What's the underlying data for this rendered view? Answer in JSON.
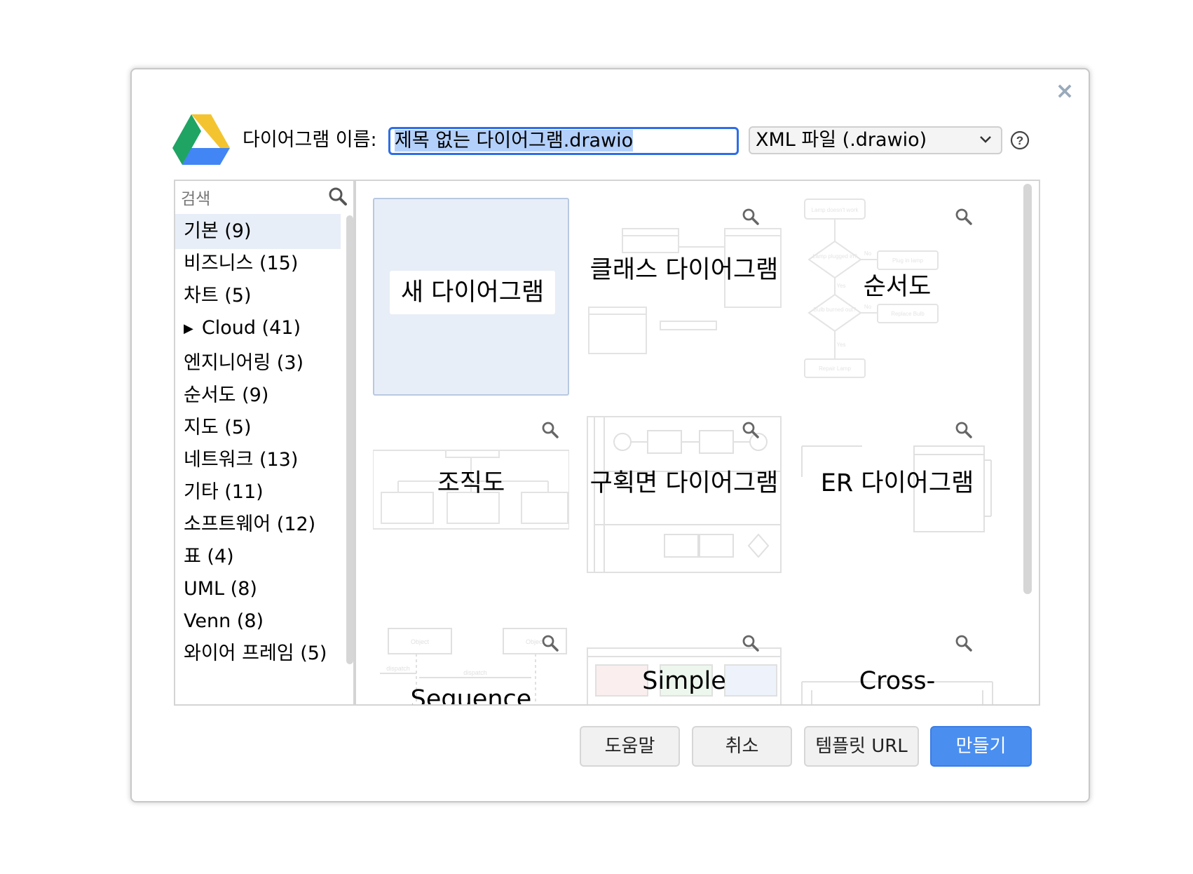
{
  "dialog": {
    "close_glyph": "×",
    "name_label": "다이어그램 이름:",
    "filename": "제목 없는 다이어그램.drawio",
    "format": "XML 파일 (.drawio)",
    "help_glyph": "?"
  },
  "search": {
    "placeholder": "검색"
  },
  "categories": [
    {
      "label": "기본 (9)",
      "active": true
    },
    {
      "label": "비즈니스 (15)"
    },
    {
      "label": "차트 (5)"
    },
    {
      "label": "Cloud (41)",
      "expandable": true,
      "arrow": "▶"
    },
    {
      "label": "엔지니어링 (3)"
    },
    {
      "label": "순서도 (9)"
    },
    {
      "label": "지도 (5)"
    },
    {
      "label": "네트워크 (13)"
    },
    {
      "label": "기타 (11)"
    },
    {
      "label": "소프트웨어 (12)"
    },
    {
      "label": "표 (4)"
    },
    {
      "label": "UML (8)"
    },
    {
      "label": "Venn (8)"
    },
    {
      "label": "와이어 프레임 (5)"
    }
  ],
  "templates": [
    {
      "label": "새 다이어그램",
      "selected": true
    },
    {
      "label": "클래스 다이어그램"
    },
    {
      "label": "순서도"
    },
    {
      "label": "조직도"
    },
    {
      "label": "구획면 다이어그램"
    },
    {
      "label": "ER 다이어그램"
    },
    {
      "label": "Sequence"
    },
    {
      "label": "Simple"
    },
    {
      "label": "Cross-"
    }
  ],
  "thumb_text": {
    "flow_1": "Lamp doesn't work",
    "flow_2": "Lamp plugged in?",
    "flow_3": "Plug in lamp",
    "flow_4": "Bulb burned out?",
    "flow_5": "Replace Bulb",
    "flow_6": "Repair Lamp",
    "flow_no": "No",
    "flow_yes": "Yes",
    "seq_1": "Object",
    "seq_2": "Object",
    "seq_3": "dispatch",
    "seq_4": "dispatch"
  },
  "buttons": {
    "help": "도움말",
    "cancel": "취소",
    "template_url": "템플릿 URL",
    "create": "만들기"
  },
  "colors": {
    "accent": "#4a8ef0",
    "input_border": "#2e6ee6",
    "selection": "#e8eef7"
  }
}
